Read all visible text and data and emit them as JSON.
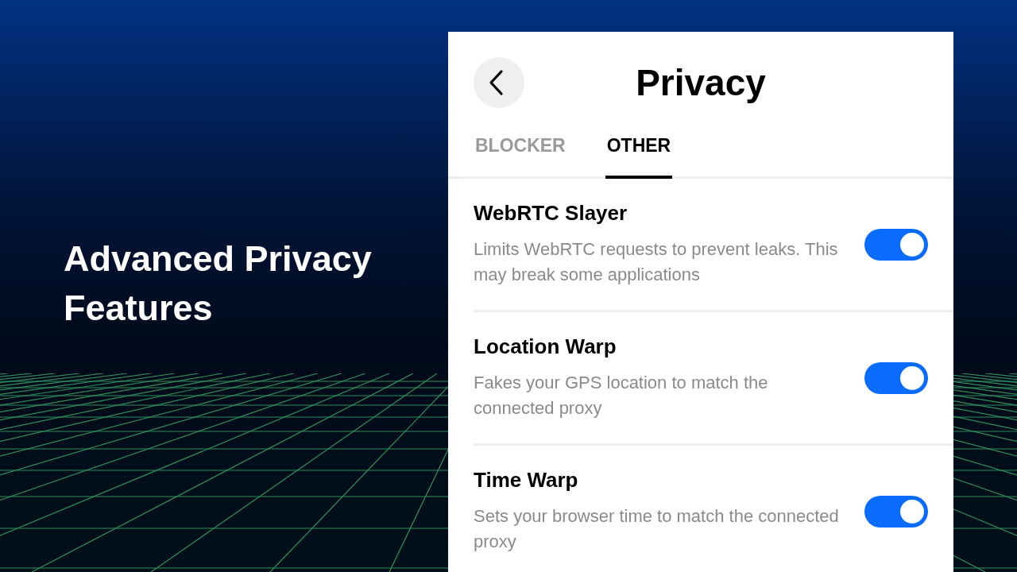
{
  "headline": "Advanced Privacy Features",
  "panel": {
    "title": "Privacy",
    "tabs": [
      {
        "label": "BLOCKER",
        "selected": false
      },
      {
        "label": "OTHER",
        "selected": true
      }
    ],
    "settings": [
      {
        "title": "WebRTC Slayer",
        "description": "Limits WebRTC requests to prevent leaks. This may break some applications",
        "on": true
      },
      {
        "title": "Location Warp",
        "description": "Fakes your GPS location to match the connected proxy",
        "on": true
      },
      {
        "title": "Time Warp",
        "description": "Sets your browser time to match the connected proxy",
        "on": true
      }
    ]
  }
}
